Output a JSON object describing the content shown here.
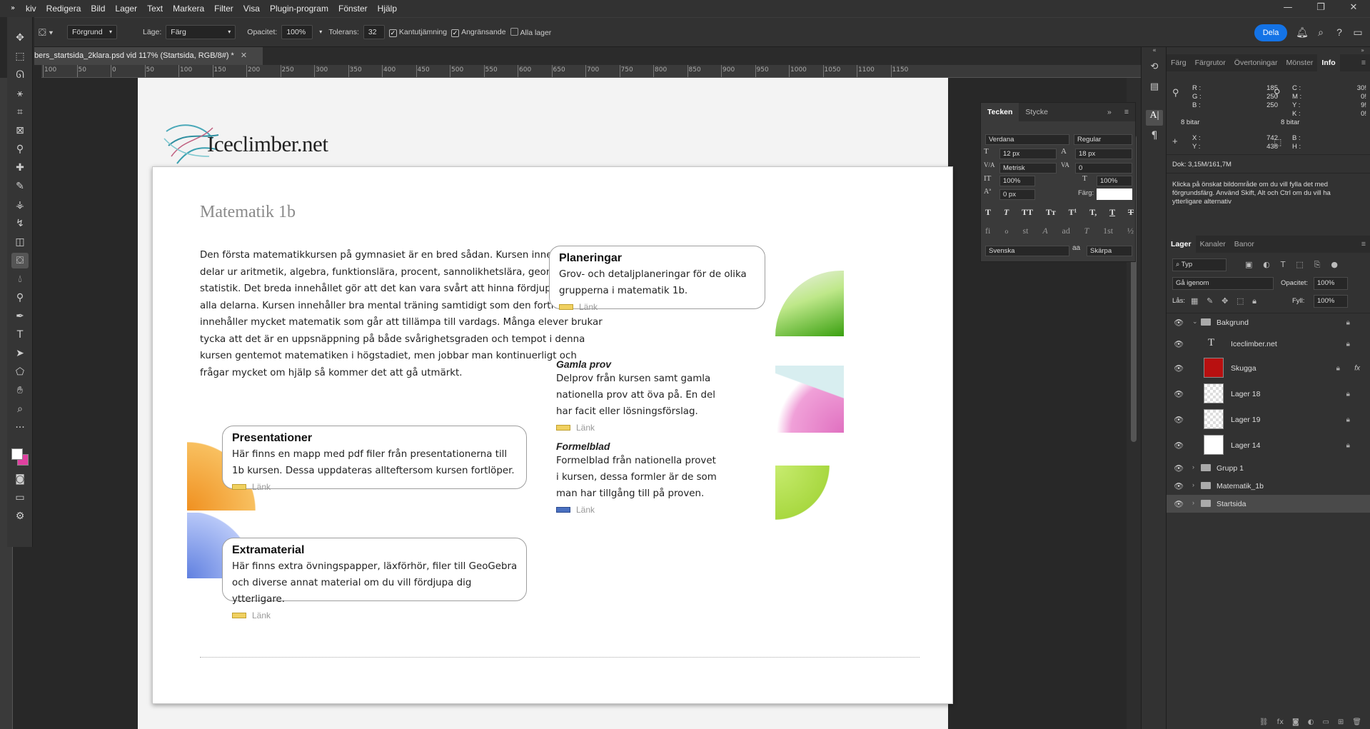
{
  "menu": [
    "kiv",
    "Redigera",
    "Bild",
    "Lager",
    "Text",
    "Markera",
    "Filter",
    "Visa",
    "Plugin-program",
    "Fönster",
    "Hjälp"
  ],
  "options": {
    "fill_source": "Förgrund",
    "mode_label": "Läge:",
    "mode_value": "Färg",
    "opacity_label": "Opacitet:",
    "opacity_value": "100%",
    "tolerance_label": "Tolerans:",
    "tolerance_value": "32",
    "antialias_label": "Kantutjämning",
    "contiguous_label": "Angränsande",
    "all_layers_label": "Alla lager",
    "share_label": "Dela"
  },
  "document_tab": "bers_startsida_2klara.psd vid 117% (Startsida, RGB/8#) *",
  "ruler_ticks": [
    "100",
    "50",
    "0",
    "50",
    "100",
    "150",
    "200",
    "250",
    "300",
    "350",
    "400",
    "450",
    "500",
    "550",
    "600",
    "650",
    "700",
    "750",
    "800",
    "850",
    "900",
    "950",
    "1000",
    "1050",
    "1100",
    "1150"
  ],
  "page": {
    "logo_text": "Iceclimber.net",
    "title": "Matematik 1b",
    "intro": "Den första matematikkursen på gymnasiet är en bred sådan. Kursen innehåller delar ur aritmetik, algebra, funktionslära, procent, sannolikhetslära, geometri och statistik. Det breda innehållet gör att det kan vara svårt att hinna fördjupa sig inom alla delarna. Kursen innehåller bra mental träning samtidigt som den fortfarande innehåller mycket matematik som går att tillämpa till vardags. Många elever brukar tycka att det är en uppsnäppning på både svårighetsgraden och tempot i denna kursen gentemot matematiken i högstadiet, men jobbar man kontinuerligt och frågar mycket om hjälp så kommer det att gå utmärkt.",
    "link_label": "Länk",
    "boxes": [
      {
        "title": "Planeringar",
        "text": "Grov- och detaljplaneringar för de olika grupperna i matematik 1b."
      },
      {
        "title": "Presentationer",
        "text": "Här finns en mapp med pdf filer från presentationerna till 1b kursen. Dessa uppdateras allteftersom kursen fortlöper."
      },
      {
        "title": "Extramaterial",
        "text": "Här finns extra övningspapper, läxförhör, filer till GeoGebra och diverse annat material om du vill fördjupa dig ytterligare."
      }
    ],
    "sides": [
      {
        "title": "Gamla prov",
        "text": "Delprov från kursen samt gamla nationella prov att öva på. En del har facit eller lösningsförslag."
      },
      {
        "title": "Formelblad",
        "text": "Formelblad från nationella provet i kursen, dessa formler är de som man har tillgång till på proven."
      }
    ]
  },
  "character_panel": {
    "tabs": [
      "Tecken",
      "Stycke"
    ],
    "font_family": "Verdana",
    "font_style": "Regular",
    "size": "12 px",
    "leading": "18 px",
    "kerning": "Metrisk",
    "tracking": "0",
    "vscale": "100%",
    "hscale": "100%",
    "baseline": "0 px",
    "color_label": "Färg:",
    "language": "Svenska",
    "aa_label": "aa",
    "aa_value": "Skärpa",
    "style_buttons": [
      "T",
      "T",
      "TT",
      "Tт",
      "T¹",
      "T,",
      "T",
      "T"
    ],
    "ot_buttons": [
      "fi",
      "ℴ",
      "st",
      "A",
      "ad",
      "T",
      "1st",
      "½"
    ]
  },
  "info_panel": {
    "tabs": [
      "Färg",
      "Färgrutor",
      "Övertoningar",
      "Mönster",
      "Info"
    ],
    "r_label": "R :",
    "r": "185",
    "g_label": "G :",
    "g": "250",
    "b_label": "B :",
    "b": "250",
    "c_label": "C :",
    "c": "30!",
    "m_label": "M :",
    "m": "0!",
    "y_label": "Y :",
    "y": "9!",
    "k_label": "K :",
    "k": "0!",
    "bits_left": "8 bitar",
    "bits_right": "8 bitar",
    "x_label": "X :",
    "x": "742",
    "yc_label": "Y :",
    "yc": "438",
    "w_label": "B :",
    "h_label": "H :",
    "doc": "Dok: 3,15M/161,7M",
    "hint": "Klicka på önskat bildområde om du vill fylla det med förgrundsfärg. Använd Skift, Alt och Ctrl om du vill ha ytterligare alternativ"
  },
  "layers_panel": {
    "tabs": [
      "Lager",
      "Kanaler",
      "Banor"
    ],
    "filter": "Typ",
    "blend": "Gå igenom",
    "opacity_label": "Opacitet:",
    "opacity": "100%",
    "lock_label": "Lås:",
    "fill_label": "Fyll:",
    "fill": "100%",
    "layers": [
      {
        "name": "Bakgrund",
        "kind": "group-open"
      },
      {
        "name": "Iceclimber.net",
        "kind": "text"
      },
      {
        "name": "Skugga",
        "kind": "red",
        "fx": "fx"
      },
      {
        "name": "Lager 18",
        "kind": "transparent"
      },
      {
        "name": "Lager 19",
        "kind": "transparent"
      },
      {
        "name": "Lager 14",
        "kind": "white"
      },
      {
        "name": "Grupp 1",
        "kind": "group"
      },
      {
        "name": "Matematik_1b",
        "kind": "group"
      },
      {
        "name": "Startsida",
        "kind": "group-selected"
      }
    ]
  },
  "colors": {
    "accent": "#1473e6",
    "foreground": "#ffffff",
    "background": "#e040a0",
    "skugga": "#b81010"
  }
}
